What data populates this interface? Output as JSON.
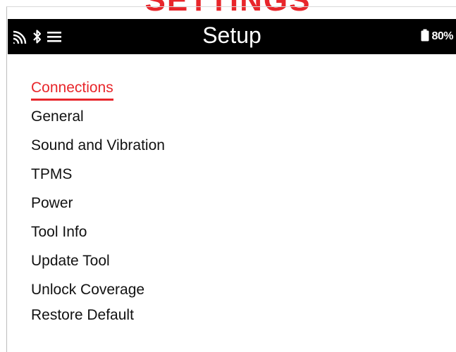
{
  "heading": "SETTINGS",
  "statusbar": {
    "title": "Setup",
    "battery_percent": "80%",
    "icons": [
      "wifi-signal-icon",
      "bluetooth-icon",
      "menu-icon",
      "battery-icon"
    ]
  },
  "colors": {
    "accent": "#e8262b",
    "statusbar_bg": "#000000",
    "text": "#111111"
  },
  "menu": {
    "selected_index": 0,
    "items": [
      {
        "label": "Connections"
      },
      {
        "label": "General"
      },
      {
        "label": "Sound and Vibration"
      },
      {
        "label": "TPMS"
      },
      {
        "label": "Power"
      },
      {
        "label": "Tool Info"
      },
      {
        "label": "Update Tool"
      },
      {
        "label": "Unlock Coverage"
      },
      {
        "label": "Restore Default"
      }
    ]
  }
}
